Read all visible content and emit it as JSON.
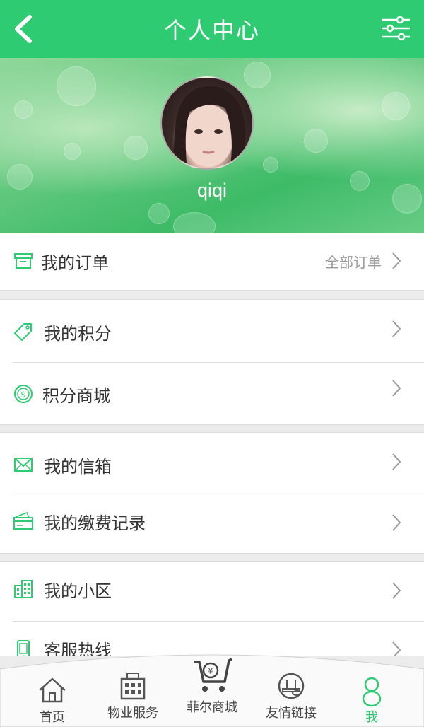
{
  "header": {
    "title": "个人中心",
    "back_icon": "chevron-left-icon",
    "settings_icon": "filter-sliders-icon",
    "bg_color": "#2ecb72"
  },
  "profile": {
    "username": "qiqi"
  },
  "menu": {
    "orders": {
      "label": "我的订单",
      "extra": "全部订单",
      "icon": "box-icon"
    },
    "points": {
      "label": "我的积分",
      "icon": "tag-icon"
    },
    "mall": {
      "label": "积分商城",
      "icon": "coin-icon"
    },
    "inbox": {
      "label": "我的信箱",
      "icon": "envelope-icon"
    },
    "payments": {
      "label": "我的缴费记录",
      "icon": "card-icon"
    },
    "community": {
      "label": "我的小区",
      "icon": "buildings-icon"
    },
    "hotline": {
      "label": "客服热线",
      "icon": "phone-icon"
    }
  },
  "tabbar": {
    "home": "首页",
    "property": "物业服务",
    "shop": "菲尔商城",
    "links": "友情链接",
    "me": "我",
    "active_color": "#2ecb72"
  }
}
